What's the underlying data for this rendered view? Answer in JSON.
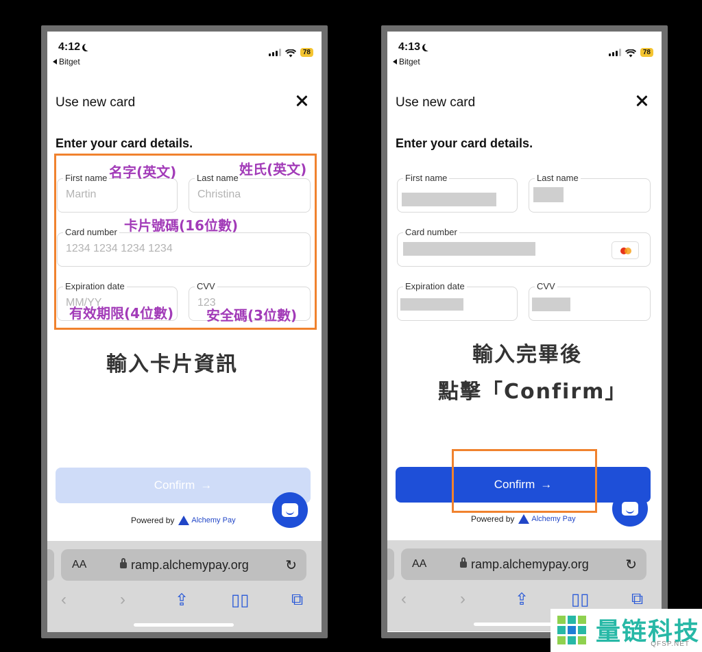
{
  "left": {
    "status": {
      "time": "4:12",
      "back": "Bitget",
      "battery": "78"
    },
    "title": "Use new card",
    "heading": "Enter your card details.",
    "fields": {
      "first_name": {
        "label": "First name",
        "placeholder": "Martin"
      },
      "last_name": {
        "label": "Last name",
        "placeholder": "Christina"
      },
      "card_number": {
        "label": "Card number",
        "placeholder": "1234 1234 1234 1234"
      },
      "expiration": {
        "label": "Expiration date",
        "placeholder": "MM/YY"
      },
      "cvv": {
        "label": "CVV",
        "placeholder": "123"
      }
    },
    "notes": {
      "first_name": "名字(英文)",
      "last_name": "姓氏(英文)",
      "card_number": "卡片號碼(16位數)",
      "expiration": "有效期限(4位數)",
      "cvv": "安全碼(3位數)"
    },
    "caption": "輸入卡片資訊",
    "confirm": {
      "label": "Confirm",
      "arrow": "→",
      "enabled": false
    },
    "powered_by": "Powered by",
    "brand": "Alchemy Pay",
    "url": "ramp.alchemypay.org",
    "url_aa": "AA"
  },
  "right": {
    "status": {
      "time": "4:13",
      "back": "Bitget",
      "battery": "78"
    },
    "title": "Use new card",
    "heading": "Enter your card details.",
    "fields": {
      "first_name": {
        "label": "First name"
      },
      "last_name": {
        "label": "Last name"
      },
      "card_number": {
        "label": "Card number"
      },
      "expiration": {
        "label": "Expiration date"
      },
      "cvv": {
        "label": "CVV"
      }
    },
    "caption_line1": "輸入完畢後",
    "caption_line2": "點擊「Confirm」",
    "confirm": {
      "label": "Confirm",
      "arrow": "→",
      "enabled": true
    },
    "powered_by": "Powered by",
    "brand": "Alchemy Pay",
    "url": "ramp.alchemypay.org",
    "url_aa": "AA"
  },
  "colors": {
    "accent": "#1e4fd8",
    "highlight": "#f0822e",
    "annotation": "#a23bb8",
    "disabled_button": "#cfdcf8"
  },
  "watermark": {
    "brand": "量链科技",
    "domain": "QFSP.NET"
  }
}
